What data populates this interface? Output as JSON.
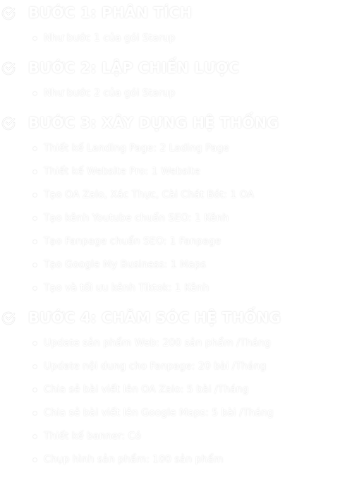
{
  "steps": [
    {
      "icon": "check-circle-icon",
      "title": "BƯỚC 1: PHÂN TÍCH",
      "items": [
        "Như bước 1 của gói Starup"
      ]
    },
    {
      "icon": "check-circle-icon",
      "title": "BƯỚC 2: LẬP CHIẾN LƯỢC",
      "items": [
        "Như bước 2 của gói Starup"
      ]
    },
    {
      "icon": "check-circle-icon",
      "title": "BƯỚC 3: XÂY DỰNG HỆ THỐNG",
      "items": [
        "Thiết kế Landing Page: 2 Lading Page",
        "Thiết kế Website Pro: 1 Website",
        "Tạo OA Zalo, Xác Thực, Cài Chát Bót: 1 OA",
        "Tạo kênh Youtube chuẩn SEO: 1 Kênh",
        "Tạo Fanpage chuẩn SEO: 1 Fanpage",
        "Tạo Google My Business: 1 Maps",
        "Tạo và tối ưu kênh Tiktok: 1 Kênh"
      ]
    },
    {
      "icon": "check-circle-icon",
      "title": "BƯỚC 4: CHĂM SÓC HỆ THỐNG",
      "items": [
        "Update sản phẩm Web: 200 sản phẩm /Tháng",
        "Update nội dung cho Fanpage: 20 bài /Tháng",
        "Chia sẻ bài viết lên OA Zalo: 5 bài /Tháng",
        "Chia sẻ bài viết lên Google Maps: 5 bài /Tháng",
        "Thiết kế banner: Có",
        "Chụp hình sản phẩm: 100 sản phẩm"
      ]
    }
  ],
  "colors": {
    "text": "#ffffff",
    "background": "#ffffff",
    "glyph_edge": "#e6e6e6"
  }
}
